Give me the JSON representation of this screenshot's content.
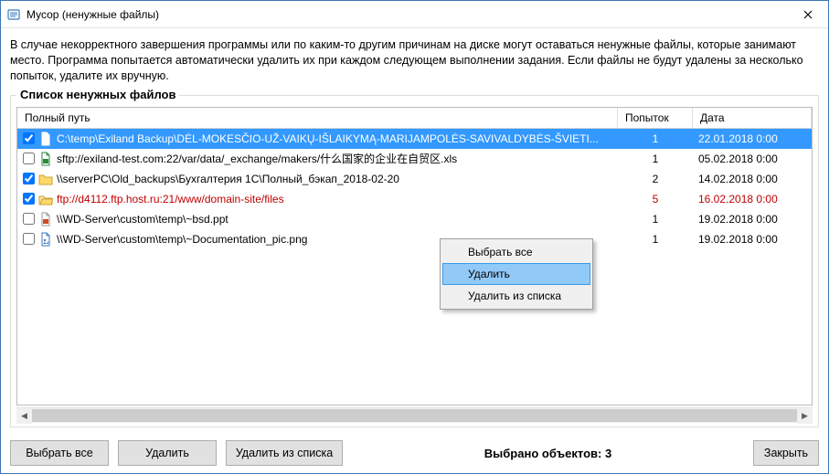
{
  "window": {
    "title": "Мусор (ненужные файлы)"
  },
  "explain": "В случае некорректного завершения программы или по каким-то другим причинам на диске могут оставаться ненужные файлы, которые занимают место. Программа попытается автоматически удалить их при каждом следующем выполнении задания. Если файлы не будут удалены за несколько попыток, удалите их вручную.",
  "groupbox_title": "Список ненужных файлов",
  "columns": {
    "path": "Полный путь",
    "attempts": "Попыток",
    "date": "Дата"
  },
  "rows": [
    {
      "checked": true,
      "selected": true,
      "error": false,
      "icon": "file-white",
      "path": "C:\\temp\\Exiland Backup\\DĖL-MOKESČIO-UŽ-VAIKŲ-IŠLAIKYMĄ-MARIJAMPOLĖS-SAVIVALDYBĖS-ŠVIETI...",
      "attempts": "1",
      "date": "22.01.2018  0:00"
    },
    {
      "checked": false,
      "selected": false,
      "error": false,
      "icon": "xls",
      "path": "sftp://exiland-test.com:22/var/data/_exchange/makers/什么国家的企业在自贸区.xls",
      "attempts": "1",
      "date": "05.02.2018  0:00"
    },
    {
      "checked": true,
      "selected": false,
      "error": false,
      "icon": "folder",
      "path": "\\\\serverPC\\Old_backups\\Бухгалтерия 1С\\Полный_бэкап_2018-02-20",
      "attempts": "2",
      "date": "14.02.2018  0:00"
    },
    {
      "checked": true,
      "selected": false,
      "error": true,
      "icon": "folder-open",
      "path": "ftp://d4112.ftp.host.ru:21/www/domain-site/files",
      "attempts": "5",
      "date": "16.02.2018  0:00"
    },
    {
      "checked": false,
      "selected": false,
      "error": false,
      "icon": "ppt",
      "path": "\\\\WD-Server\\custom\\temp\\~bsd.ppt",
      "attempts": "1",
      "date": "19.02.2018  0:00"
    },
    {
      "checked": false,
      "selected": false,
      "error": false,
      "icon": "png",
      "path": "\\\\WD-Server\\custom\\temp\\~Documentation_pic.png",
      "attempts": "1",
      "date": "19.02.2018  0:00"
    }
  ],
  "context_menu": {
    "select_all": "Выбрать все",
    "delete": "Удалить",
    "remove_from_list": "Удалить из списка"
  },
  "footer": {
    "select_all": "Выбрать все",
    "delete": "Удалить",
    "remove_from_list": "Удалить из списка",
    "status": "Выбрано объектов: 3",
    "close": "Закрыть"
  }
}
